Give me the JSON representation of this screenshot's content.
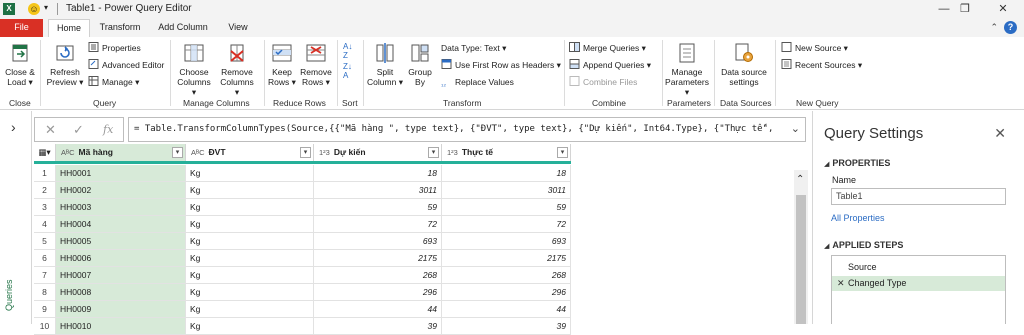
{
  "window": {
    "title": "Table1 - Power Query Editor",
    "controls": {
      "minimize": "—",
      "restore": "❐",
      "close": "✕"
    }
  },
  "tabs": [
    "File",
    "Home",
    "Transform",
    "Add Column",
    "View"
  ],
  "active_tab": "Home",
  "help": "?",
  "ribbon": {
    "close": {
      "group": "Close",
      "btn": "Close &",
      "btn2": "Load"
    },
    "query": {
      "group": "Query",
      "refresh": "Refresh",
      "refresh2": "Preview",
      "properties": "Properties",
      "advanced_editor": "Advanced Editor",
      "manage": "Manage"
    },
    "manage_columns": {
      "group": "Manage Columns",
      "choose": "Choose",
      "choose2": "Columns",
      "remove": "Remove",
      "remove2": "Columns"
    },
    "reduce_rows": {
      "group": "Reduce Rows",
      "keep": "Keep",
      "keep2": "Rows",
      "remove": "Remove",
      "remove2": "Rows"
    },
    "sort": {
      "group": "Sort"
    },
    "transform": {
      "group": "Transform",
      "split": "Split",
      "split2": "Column",
      "group_by": "Group",
      "group_by2": "By",
      "data_type": "Data Type: Text",
      "first_row": "Use First Row as Headers",
      "replace": "Replace Values"
    },
    "combine": {
      "group": "Combine",
      "merge": "Merge Queries",
      "append": "Append Queries",
      "combine_files": "Combine Files"
    },
    "parameters": {
      "group": "Parameters",
      "btn": "Manage",
      "btn2": "Parameters"
    },
    "data_sources": {
      "group": "Data Sources",
      "btn": "Data source",
      "btn2": "settings"
    },
    "new_query": {
      "group": "New Query",
      "new_source": "New Source",
      "recent": "Recent Sources"
    }
  },
  "queries_pane": {
    "label": "Queries"
  },
  "formula_bar": {
    "text": "= Table.TransformColumnTypes(Source,{{\"Mã hàng \", type text}, {\"ĐVT\", type text}, {\"Dự kiến\", Int64.Type}, {\"Thực tế\","
  },
  "grid": {
    "columns": [
      {
        "type_icon": "AᴮC",
        "name": "Mã hàng"
      },
      {
        "type_icon": "AᴮC",
        "name": "ĐVT"
      },
      {
        "type_icon": "1²3",
        "name": "Dự kiến"
      },
      {
        "type_icon": "1²3",
        "name": "Thực tế"
      }
    ],
    "rows": [
      {
        "idx": "1",
        "ma": "HH0001",
        "dvt": "Kg",
        "dk": "18",
        "tt": "18"
      },
      {
        "idx": "2",
        "ma": "HH0002",
        "dvt": "Kg",
        "dk": "3011",
        "tt": "3011"
      },
      {
        "idx": "3",
        "ma": "HH0003",
        "dvt": "Kg",
        "dk": "59",
        "tt": "59"
      },
      {
        "idx": "4",
        "ma": "HH0004",
        "dvt": "Kg",
        "dk": "72",
        "tt": "72"
      },
      {
        "idx": "5",
        "ma": "HH0005",
        "dvt": "Kg",
        "dk": "693",
        "tt": "693"
      },
      {
        "idx": "6",
        "ma": "HH0006",
        "dvt": "Kg",
        "dk": "2175",
        "tt": "2175"
      },
      {
        "idx": "7",
        "ma": "HH0007",
        "dvt": "Kg",
        "dk": "268",
        "tt": "268"
      },
      {
        "idx": "8",
        "ma": "HH0008",
        "dvt": "Kg",
        "dk": "296",
        "tt": "296"
      },
      {
        "idx": "9",
        "ma": "HH0009",
        "dvt": "Kg",
        "dk": "44",
        "tt": "44"
      },
      {
        "idx": "10",
        "ma": "HH0010",
        "dvt": "Kg",
        "dk": "39",
        "tt": "39"
      }
    ]
  },
  "query_settings": {
    "title": "Query Settings",
    "properties_header": "PROPERTIES",
    "name_label": "Name",
    "name_value": "Table1",
    "all_properties": "All Properties",
    "applied_steps_header": "APPLIED STEPS",
    "steps": [
      "Source",
      "Changed Type"
    ]
  },
  "colors": {
    "accent": "#217346",
    "file_tab": "#d93025",
    "selection": "#d7ead8",
    "header_bar": "#25b099"
  }
}
